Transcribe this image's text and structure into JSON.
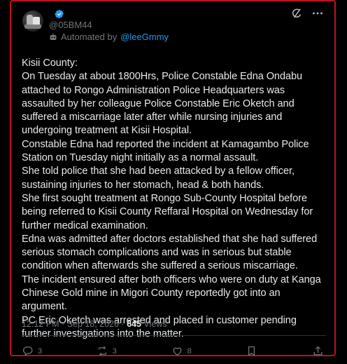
{
  "tweet": {
    "display_name": "",
    "handle": "@05BM44",
    "automated_prefix": "Automated by",
    "automated_link": "@leeGmmy",
    "body": "Kisii County:\nOn Tuesday at about 1800Hrs, Police Constable Edna Ondabu attached to Rongo Administration Police Headquarters was assaulted by her colleague Police Constable Eric Oketch and suffered a miscarriage later after while nursing injuries and undergoing treatment at Kisii Hospital.\nConstable Edna had reported the incident at Kamagambo Police Station on Tuesday night initially as a normal assault.\nShe told police that she had been attacked by a fellow officer, sustaining injuries to her stomach, head & both hands.\nShe first sought treatment at Rongo Sub-County Hospital before being referred to Kisii County Reffaral Hospital on Wednesday for further medical examination.\nEdna was admitted after doctors established that she had suffered serious stomach complications and was in serious but stable condition when afterwards she suffered a serious miscarriage.\nThe incident ensured after both officers who were on duty at Kanga Chinese Gold mine in Migori County reportedly got into an argument.\nPC Eric Oketch was arrested and placed in customer pending further investigations into the matter.",
    "timestamp": "12:12 PM · Sep 18, 2026 · ",
    "views_count": "645",
    "views_label": " Views",
    "replies": "3",
    "reposts": "3",
    "likes": "8"
  },
  "colors": {
    "background": "#000000",
    "text": "#e7e9ea",
    "muted": "#71767b",
    "accent": "#1d9bf0",
    "frame_border": "#c0101e"
  },
  "icons": [
    "verified-badge-icon",
    "bot-icon",
    "grok-icon",
    "more-icon",
    "reply-icon",
    "repost-icon",
    "like-icon",
    "bookmark-icon",
    "share-icon"
  ]
}
